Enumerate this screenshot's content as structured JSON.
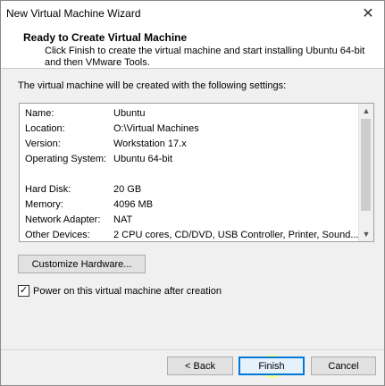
{
  "window": {
    "title": "New Virtual Machine Wizard",
    "close_glyph": "✕"
  },
  "header": {
    "title": "Ready to Create Virtual Machine",
    "description": "Click Finish to create the virtual machine and start installing Ubuntu 64-bit and then VMware Tools."
  },
  "intro": "The virtual machine will be created with the following settings:",
  "settings": [
    {
      "key": "Name:",
      "value": "Ubuntu"
    },
    {
      "key": "Location:",
      "value": "O:\\Virtual Machines"
    },
    {
      "key": "Version:",
      "value": "Workstation 17.x"
    },
    {
      "key": "Operating System:",
      "value": "Ubuntu 64-bit"
    },
    {
      "key": "Hard Disk:",
      "value": "20 GB"
    },
    {
      "key": "Memory:",
      "value": "4096 MB"
    },
    {
      "key": "Network Adapter:",
      "value": "NAT"
    },
    {
      "key": "Other Devices:",
      "value": "2 CPU cores, CD/DVD, USB Controller, Printer, Sound..."
    }
  ],
  "scrollbar": {
    "up_glyph": "▲",
    "down_glyph": "▼"
  },
  "customize_label": "Customize Hardware...",
  "power_on": {
    "label": "Power on this virtual machine after creation",
    "checked": true,
    "check_glyph": "✓"
  },
  "buttons": {
    "back": "< Back",
    "finish": "Finish",
    "cancel": "Cancel"
  }
}
